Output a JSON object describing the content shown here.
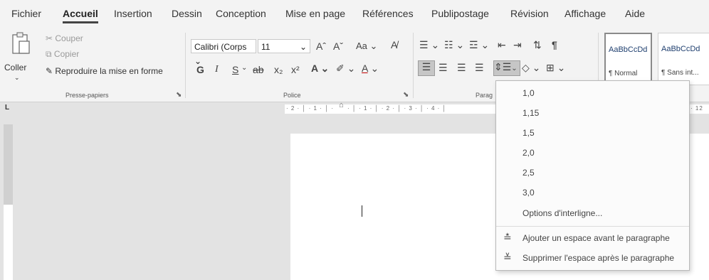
{
  "tabs": [
    "Fichier",
    "Accueil",
    "Insertion",
    "Dessin",
    "Conception",
    "Mise en page",
    "Références",
    "Publipostage",
    "Révision",
    "Affichage",
    "Aide"
  ],
  "active_tab": "Accueil",
  "clipboard": {
    "paste_label": "Coller",
    "cut_label": "Couper",
    "copy_label": "Copier",
    "format_painter_label": "Reproduire la mise en forme",
    "group_label": "Presse-papiers"
  },
  "font": {
    "font_name": "Calibri (Corps",
    "font_size": "11",
    "grow": "Aˆ",
    "shrink": "Aˇ",
    "case": "Aa",
    "bold": "G",
    "italic": "I",
    "underline": "S",
    "strike": "ab",
    "subscript": "x₂",
    "superscript": "x²",
    "group_label": "Police"
  },
  "paragraph": {
    "group_label": "Parag"
  },
  "styles": [
    {
      "sample": "AaBbCcDd",
      "name": "¶ Normal"
    },
    {
      "sample": "AaBbCcDd",
      "name": "¶ Sans int..."
    }
  ],
  "ruler": {
    "left_text": "· 2 · │ · 1 · │ ·",
    "mid_text": "· │ · 1 · │ · 2 · │ · 3 · │ · 4 · │",
    "right_text": "· 12"
  },
  "tab_selector": "L",
  "line_spacing_menu": {
    "options": [
      "1,0",
      "1,15",
      "1,5",
      "2,0",
      "2,5",
      "3,0"
    ],
    "more_options": "Options d'interligne...",
    "add_space_before": "Ajouter un espace avant le paragraphe",
    "remove_space_after": "Supprimer l'espace après le paragraphe"
  }
}
